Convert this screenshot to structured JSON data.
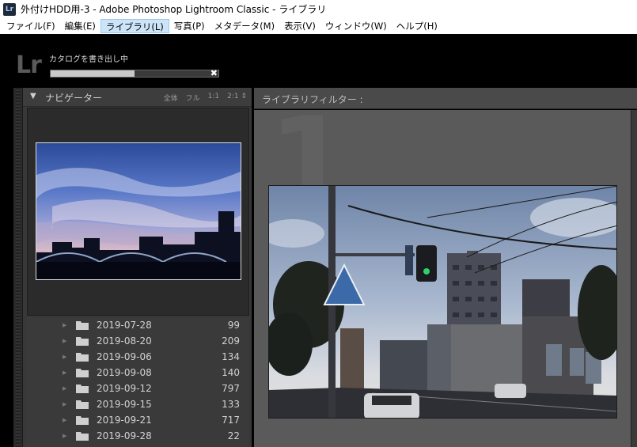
{
  "window": {
    "icon_text": "Lr",
    "title": "外付けHDD用-3 - Adobe Photoshop Lightroom Classic - ライブラリ"
  },
  "menu": [
    {
      "label": "ファイル(F)"
    },
    {
      "label": "編集(E)"
    },
    {
      "label": "ライブラリ(L)",
      "active": true
    },
    {
      "label": "写真(P)"
    },
    {
      "label": "メタデータ(M)"
    },
    {
      "label": "表示(V)"
    },
    {
      "label": "ウィンドウ(W)"
    },
    {
      "label": "ヘルプ(H)"
    }
  ],
  "identity": {
    "logo": "Lr",
    "progress_label": "カタログを書き出し中",
    "progress_fraction": 0.5,
    "cancel_icon": "close-icon",
    "cancel_glyph": "✖"
  },
  "navigator": {
    "collapse_glyph": "▼",
    "title": "ナビゲーター",
    "zoom": [
      "全体",
      "フル",
      "1:1",
      "2:1 ⇕"
    ]
  },
  "folders": [
    {
      "name": "2019-07-28",
      "count": "99"
    },
    {
      "name": "2019-08-20",
      "count": "209"
    },
    {
      "name": "2019-09-06",
      "count": "134"
    },
    {
      "name": "2019-09-08",
      "count": "140"
    },
    {
      "name": "2019-09-12",
      "count": "797"
    },
    {
      "name": "2019-09-15",
      "count": "133"
    },
    {
      "name": "2019-09-21",
      "count": "717"
    },
    {
      "name": "2019-09-28",
      "count": "22"
    }
  ],
  "filter": {
    "label": "ライブラリフィルター :"
  },
  "center": {
    "ghost_number": "1"
  },
  "colors": {
    "panel": "#383838",
    "center_bg": "#5a5a5a",
    "menu_active": "#cce4f7"
  }
}
